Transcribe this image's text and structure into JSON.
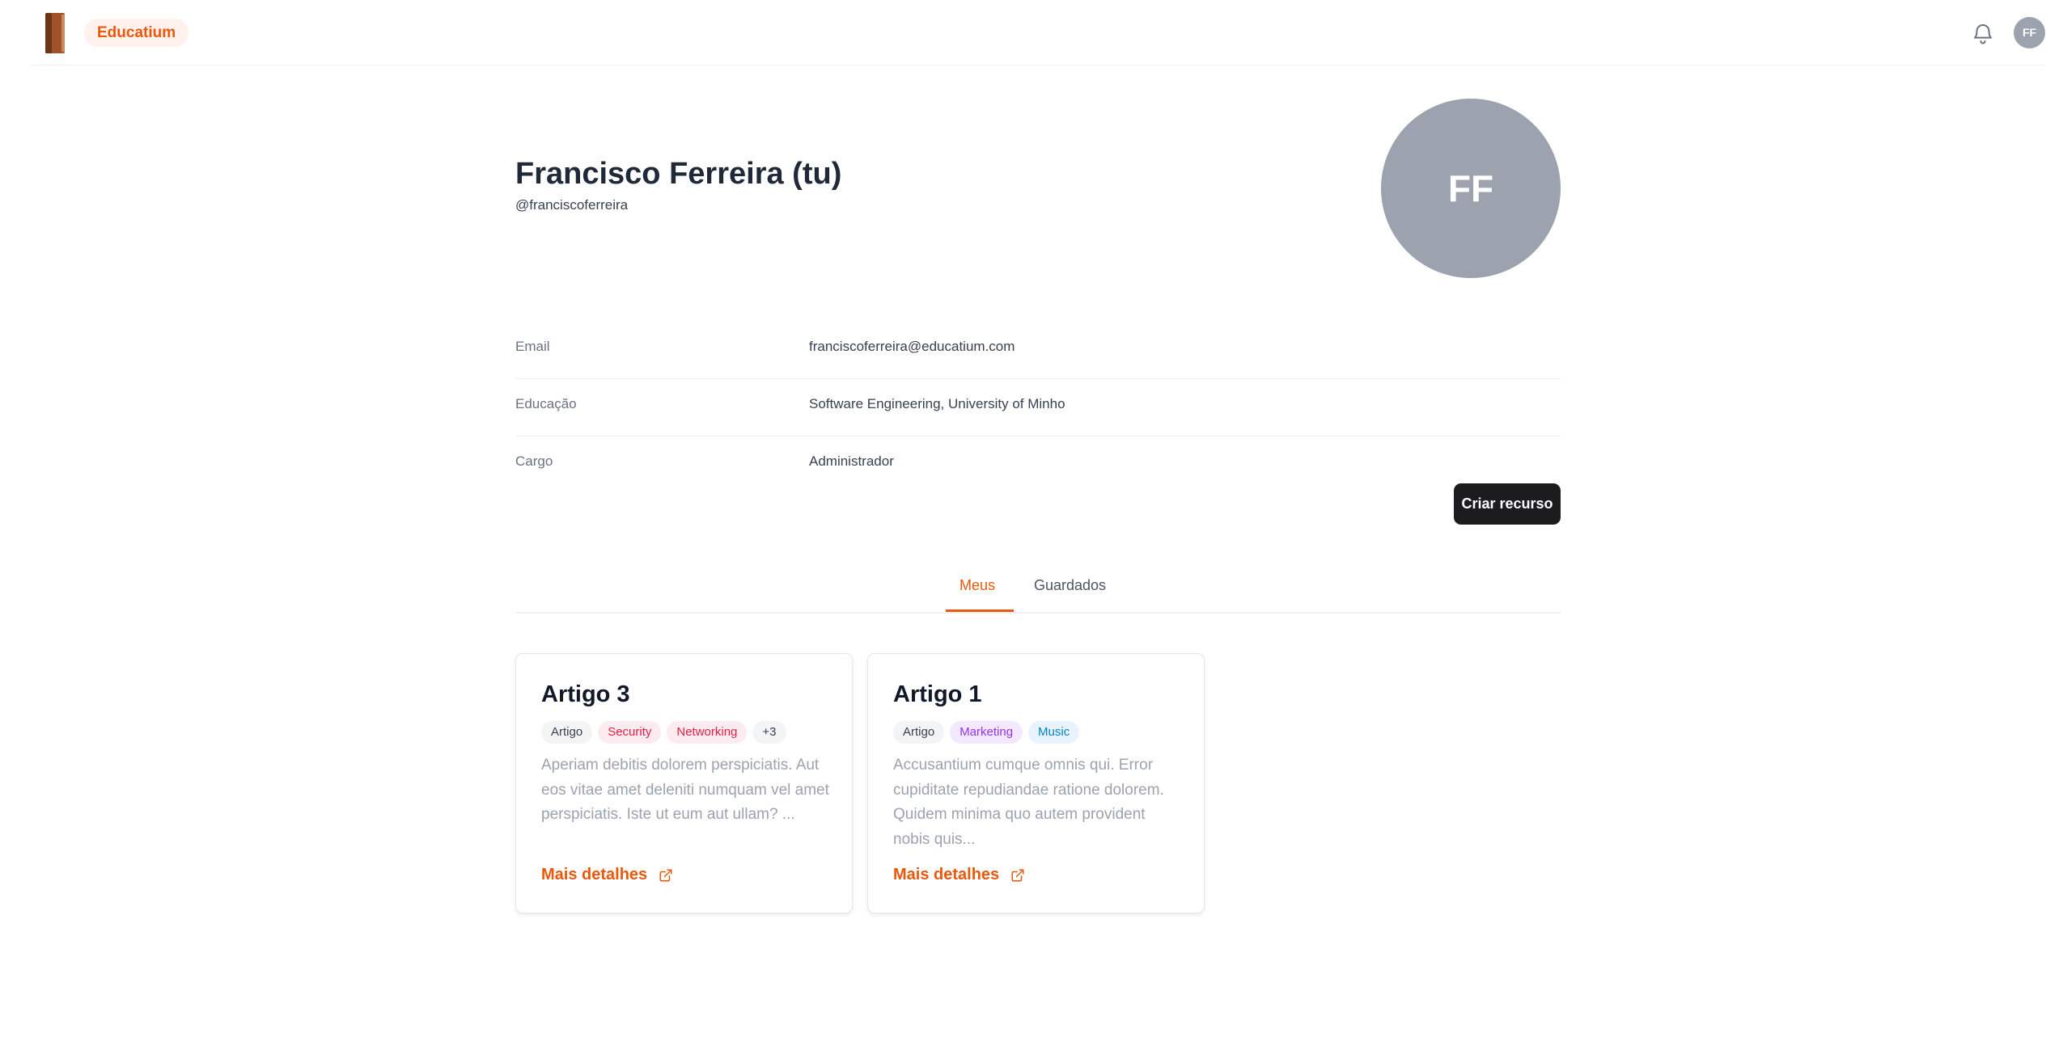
{
  "header": {
    "brand": "Educatium",
    "user_initials": "FF"
  },
  "profile": {
    "name": "Francisco Ferreira (tu)",
    "handle": "@franciscoferreira",
    "avatar_initials": "FF",
    "fields": [
      {
        "label": "Email",
        "value": "franciscoferreira@educatium.com"
      },
      {
        "label": "Educação",
        "value": "Software Engineering, University of Minho"
      },
      {
        "label": "Cargo",
        "value": "Administrador"
      }
    ],
    "create_button": "Criar recurso"
  },
  "tabs": [
    {
      "label": "Meus",
      "active": true
    },
    {
      "label": "Guardados",
      "active": false
    }
  ],
  "cards": [
    {
      "title": "Artigo 3",
      "tags": [
        {
          "label": "Artigo",
          "bg": "#f3f4f6",
          "fg": "#374151"
        },
        {
          "label": "Security",
          "bg": "#fdecef",
          "fg": "#e11d48"
        },
        {
          "label": "Networking",
          "bg": "#fdecef",
          "fg": "#e11d48"
        },
        {
          "label": "+3",
          "bg": "#f3f4f6",
          "fg": "#374151"
        }
      ],
      "description": "Aperiam debitis dolorem perspiciatis. Aut eos vitae amet deleniti numquam vel amet perspiciatis. Iste ut eum aut ullam? ...",
      "link": "Mais detalhes"
    },
    {
      "title": "Artigo 1",
      "tags": [
        {
          "label": "Artigo",
          "bg": "#f3f4f6",
          "fg": "#374151"
        },
        {
          "label": "Marketing",
          "bg": "#f3e8ff",
          "fg": "#9333ea"
        },
        {
          "label": "Music",
          "bg": "#e8f3fd",
          "fg": "#0284c7"
        }
      ],
      "description": "Accusantium cumque omnis qui. Error cupiditate repudiandae ratione dolorem. Quidem minima quo autem provident nobis quis...",
      "link": "Mais detalhes"
    }
  ],
  "colors": {
    "accent": "#ea580c",
    "avatar": "#9ca3af",
    "button": "#1c1c1e"
  },
  "icons": {
    "logo": "book-icon",
    "notifications": "bell-icon",
    "link": "external-link-icon"
  }
}
